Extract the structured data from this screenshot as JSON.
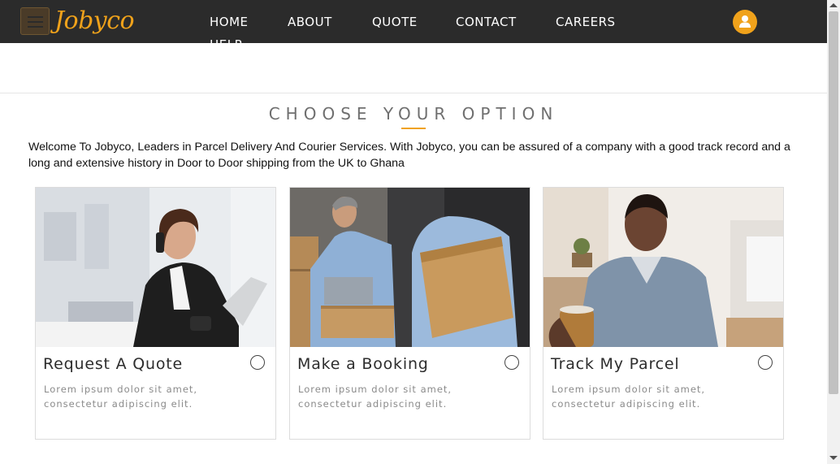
{
  "brand": {
    "logo_text": "Jobyco",
    "accent_color": "#f0a21b",
    "nav_bg": "#2b2b2b"
  },
  "nav": {
    "items": [
      {
        "label": "HOME"
      },
      {
        "label": "ABOUT"
      },
      {
        "label": "QUOTE"
      },
      {
        "label": "CONTACT"
      },
      {
        "label": "CAREERS"
      }
    ],
    "overflow_item": "HELP",
    "menu_icon": "hamburger-icon",
    "user_icon": "user-icon"
  },
  "section": {
    "title": "CHOOSE YOUR OPTION",
    "intro": "Welcome To Jobyco, Leaders in Parcel Delivery And Courier Services. With Jobyco, you can be assured of a company with a good track record and a long and extensive history in Door to Door shipping from the UK to Ghana"
  },
  "cards": [
    {
      "title": "Request A Quote",
      "description": "Lorem ipsum dolor sit amet, consectetur adipiscing elit.",
      "selected": false
    },
    {
      "title": "Make a Booking",
      "description": "Lorem ipsum dolor sit amet, consectetur adipiscing elit.",
      "selected": false
    },
    {
      "title": "Track My Parcel",
      "description": "Lorem ipsum dolor sit amet, consectetur adipiscing elit.",
      "selected": false
    }
  ]
}
